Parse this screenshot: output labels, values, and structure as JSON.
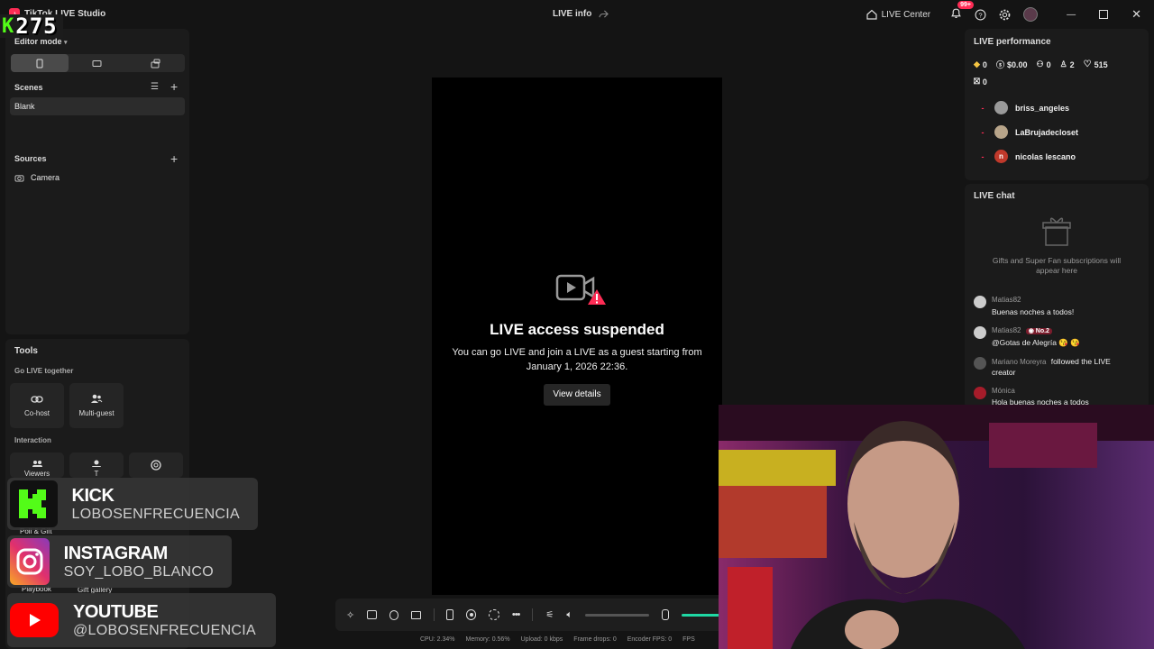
{
  "titlebar": {
    "app_name": "TikTok LIVE Studio",
    "center_title": "LIVE info",
    "live_center": "LIVE Center",
    "notif_badge": "99+"
  },
  "overlay_counter": {
    "glyph": "K",
    "value": "275"
  },
  "left": {
    "editor_mode": "Editor mode",
    "scenes_title": "Scenes",
    "scenes": [
      "Blank"
    ],
    "sources_title": "Sources",
    "sources": [
      "Camera"
    ],
    "tools_title": "Tools",
    "go_live_together": "Go LIVE together",
    "cohost": "Co-host",
    "multiguest": "Multi-guest",
    "interaction": "Interaction",
    "viewers_partial": "Viewers",
    "t_partial": "T",
    "poll_gift_partial": "Poll & Gift",
    "playbook_partial": "Playbook",
    "gift_gallery_partial": "Gift gallery"
  },
  "preview": {
    "title": "LIVE access suspended",
    "message": "You can go LIVE and join a LIVE as a guest starting from January 1, 2026 22:36.",
    "button": "View details"
  },
  "status": {
    "cpu": "CPU: 2.34%",
    "memory": "Memory: 0.56%",
    "upload": "Upload: 0 kbps",
    "frame_drops": "Frame drops: 0",
    "encoder_fps": "Encoder FPS: 0",
    "fps": "FPS"
  },
  "performance": {
    "title": "LIVE performance",
    "diamonds": "0",
    "money": "$0.00",
    "viewers": "0",
    "followers": "2",
    "likes": "515",
    "gifts": "0",
    "viewer_list": [
      {
        "name": "briss_angeles",
        "color": "#9a9a9a"
      },
      {
        "name": "LaBrujadecloset",
        "color": "#b8a58a"
      },
      {
        "name": "nicolas lescano",
        "color": "#c0392b",
        "initial": "n"
      }
    ]
  },
  "chat": {
    "title": "LIVE chat",
    "empty_note": "Gifts and Super Fan subscriptions will appear here",
    "messages": [
      {
        "user": "Matias82",
        "text": "Buenas noches a todos!"
      },
      {
        "user": "Matias82",
        "badge": "No.2",
        "text": "@Gotas de Alegría 😘 😘"
      },
      {
        "user": "Mariano Moreyra",
        "action": "followed the LIVE",
        "text": "creator"
      },
      {
        "user": "Mónica",
        "text": "Hola buenas noches a todos"
      }
    ]
  },
  "socials": [
    {
      "platform": "KICK",
      "handle": "LOBOSENFRECUENCIA",
      "color": "#53fc18"
    },
    {
      "platform": "INSTAGRAM",
      "handle": "SOY_LOBO_BLANCO",
      "color": "#e1306c"
    },
    {
      "platform": "YOUTUBE",
      "handle": "@LOBOSENFRECUENCIA",
      "color": "#ff0000"
    }
  ],
  "colors": {
    "accent": "#fe2c55",
    "kick_green": "#53fc18",
    "volume": "#1fd8a4"
  }
}
